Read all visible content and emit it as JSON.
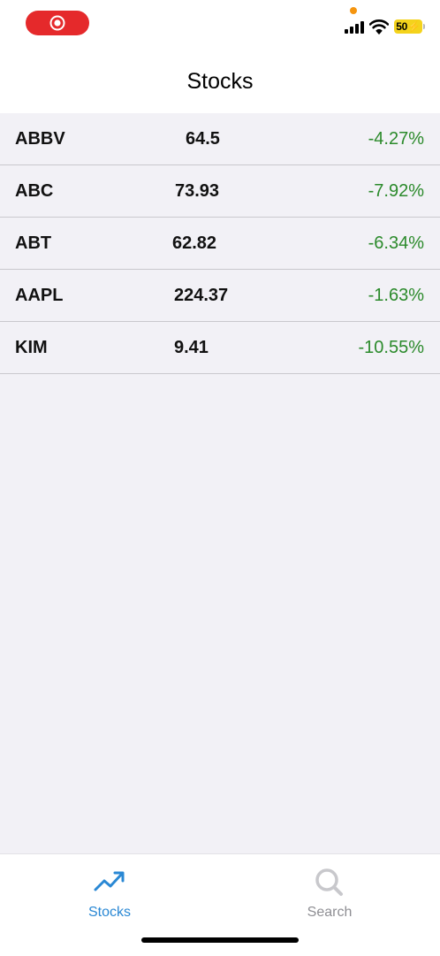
{
  "status_bar": {
    "battery_level": "50",
    "icons": [
      "screen-record-icon",
      "cellular-signal-icon",
      "wifi-icon",
      "battery-charging-icon"
    ]
  },
  "header": {
    "title": "Stocks"
  },
  "stocks": [
    {
      "ticker": "ABBV",
      "price": "64.5",
      "change": "-4.27%"
    },
    {
      "ticker": "ABC",
      "price": "73.93",
      "change": "-7.92%"
    },
    {
      "ticker": "ABT",
      "price": "62.82",
      "change": "-6.34%"
    },
    {
      "ticker": "AAPL",
      "price": "224.37",
      "change": "-1.63%"
    },
    {
      "ticker": "KIM",
      "price": "9.41",
      "change": "-10.55%"
    }
  ],
  "tab_bar": {
    "tabs": [
      {
        "label": "Stocks",
        "icon": "trending-up-icon",
        "selected": true
      },
      {
        "label": "Search",
        "icon": "search-icon",
        "selected": false
      }
    ]
  },
  "colors": {
    "accent": "#2a88d4",
    "change": "#2b8a2b",
    "record": "#e5292b",
    "battery": "#f4d31c",
    "background": "#f2f1f6"
  }
}
